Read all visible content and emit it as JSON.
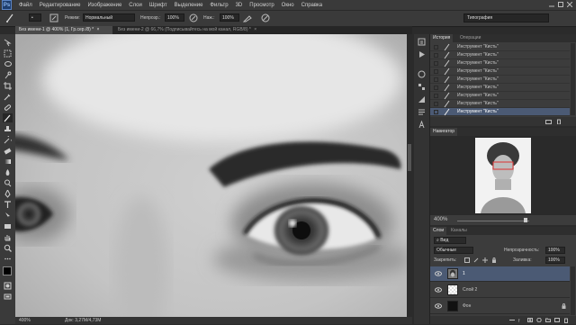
{
  "app": {
    "logo": "Ps"
  },
  "menu": [
    "Файл",
    "Редактирование",
    "Изображение",
    "Слои",
    "Шрифт",
    "Выделение",
    "Фильтр",
    "3D",
    "Просмотр",
    "Окно",
    "Справка"
  ],
  "options": {
    "mode_label": "Режим:",
    "mode_value": "Нормальный",
    "opacity_label": "Непрозр.:",
    "opacity_value": "100%",
    "pressure_label": "Наж.:",
    "pressure_value": "100%",
    "workspace": "Типография"
  },
  "tabs": [
    {
      "label": "Без имени-1 @ 400% (1, Гр.сер./8) *",
      "close": "×",
      "active": true
    },
    {
      "label": "Без имени-2 @ 66,7% (Подписывайтесь на мой канал, RGB/8) *",
      "close": "×",
      "active": false
    }
  ],
  "status": {
    "zoom": "400%",
    "doc": "Док: 3,27М/4,73М"
  },
  "history_panel": {
    "tabs": [
      "История",
      "Операции"
    ],
    "rows": [
      {
        "label": "Инструмент \"Кисть\"",
        "selected": false
      },
      {
        "label": "Инструмент \"Кисть\"",
        "selected": false
      },
      {
        "label": "Инструмент \"Кисть\"",
        "selected": false
      },
      {
        "label": "Инструмент \"Кисть\"",
        "selected": false
      },
      {
        "label": "Инструмент \"Кисть\"",
        "selected": false
      },
      {
        "label": "Инструмент \"Кисть\"",
        "selected": false
      },
      {
        "label": "Инструмент \"Кисть\"",
        "selected": false
      },
      {
        "label": "Инструмент \"Кисть\"",
        "selected": false
      },
      {
        "label": "Инструмент \"Кисть\"",
        "selected": true
      }
    ]
  },
  "navigator": {
    "title": "Навигатор",
    "zoom": "400%"
  },
  "layers_panel": {
    "tabs": [
      "Слои",
      "Каналы"
    ],
    "kind": "Вид",
    "blend": "Обычные",
    "opacity_label": "Непрозрачность:",
    "opacity_value": "100%",
    "lock_label": "Закрепить:",
    "fill_label": "Заливка:",
    "fill_value": "100%",
    "layers": [
      {
        "name": "1",
        "selected": true
      },
      {
        "name": "Слой 2",
        "selected": false
      },
      {
        "name": "Фон",
        "selected": false
      }
    ]
  },
  "colors": {
    "accent_selection": "#4b5a74",
    "menu_bg": "#3a3a3a",
    "panel_bg": "#3c3c3c"
  }
}
